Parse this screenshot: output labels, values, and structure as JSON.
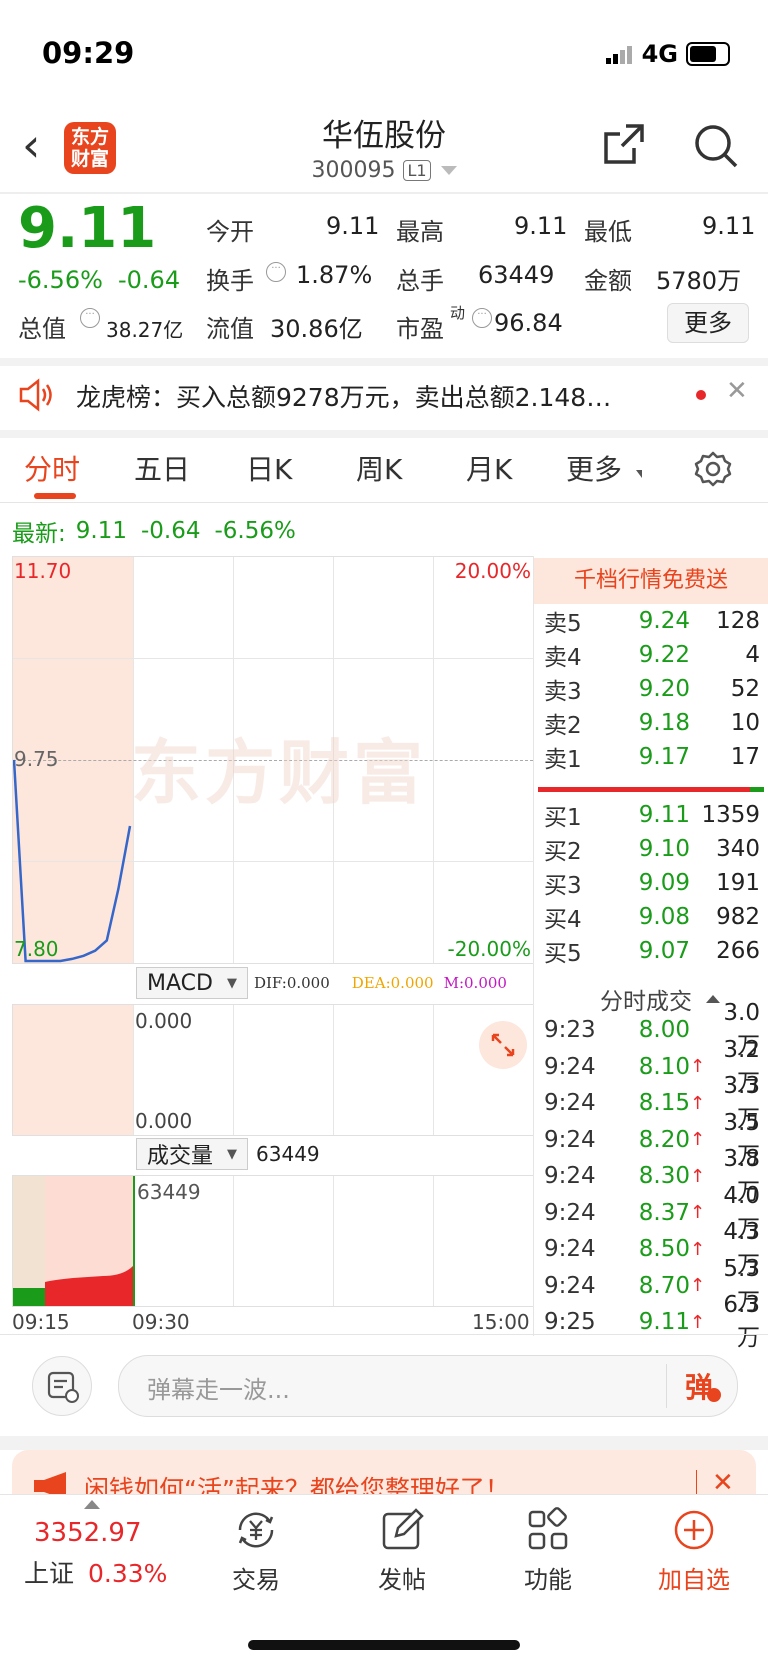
{
  "status": {
    "time": "09:29",
    "network": "4G"
  },
  "header": {
    "title": "华伍股份",
    "code": "300095",
    "level": "L1",
    "logo": "东方财富"
  },
  "quote": {
    "price": "9.11",
    "change_pct": "-6.56%",
    "change_amt": "-0.64",
    "open_label": "今开",
    "open": "9.11",
    "high_label": "最高",
    "high": "9.11",
    "low_label": "最低",
    "low": "9.11",
    "turnover_label": "换手",
    "turnover": "1.87%",
    "volume_label": "总手",
    "volume": "63449",
    "amount_label": "金额",
    "amount": "5780万",
    "total_mv_label": "总值",
    "total_mv": "38.27亿",
    "float_mv_label": "流值",
    "float_mv": "30.86亿",
    "pe_label": "市盈",
    "pe_sup": "动",
    "pe": "96.84",
    "more_label": "更多"
  },
  "notice": {
    "text": "龙虎榜：买入总额9278万元，卖出总额2.148…"
  },
  "tabs": [
    "分时",
    "五日",
    "日K",
    "周K",
    "月K",
    "更多"
  ],
  "latest": {
    "label": "最新:",
    "price": "9.11",
    "change": "-0.64",
    "pct": "-6.56%"
  },
  "chart": {
    "price_top": "11.70",
    "price_mid": "9.75",
    "price_bottom": "7.80",
    "pct_top": "20.00%",
    "pct_bottom": "-20.00%",
    "watermark": "东方财富",
    "macd_label": "MACD",
    "dif": "DIF:0.000",
    "dea": "DEA:0.000",
    "m": "M:0.000",
    "macd_top": "0.000",
    "macd_bottom": "0.000",
    "vol_label": "成交量",
    "vol_value": "63449",
    "vol_axis": "63449",
    "t_start": "09:15",
    "t_open": "09:30",
    "t_end": "15:00"
  },
  "chart_data": {
    "type": "line",
    "x": [
      "9:15",
      "9:16",
      "9:17",
      "9:18",
      "9:19",
      "9:20",
      "9:21",
      "9:22",
      "9:23",
      "9:24",
      "9:25"
    ],
    "series": [
      {
        "values": [
          9.75,
          7.8,
          7.8,
          7.8,
          7.8,
          7.82,
          7.85,
          7.9,
          8.0,
          8.5,
          9.11
        ]
      }
    ],
    "ylim": [
      7.8,
      11.7
    ]
  },
  "orderbook": {
    "banner": "千档行情免费送",
    "asks": [
      {
        "label": "卖5",
        "price": "9.24",
        "vol": "128"
      },
      {
        "label": "卖4",
        "price": "9.22",
        "vol": "4"
      },
      {
        "label": "卖3",
        "price": "9.20",
        "vol": "52"
      },
      {
        "label": "卖2",
        "price": "9.18",
        "vol": "10"
      },
      {
        "label": "卖1",
        "price": "9.17",
        "vol": "17"
      }
    ],
    "bids": [
      {
        "label": "买1",
        "price": "9.11",
        "vol": "1359"
      },
      {
        "label": "买2",
        "price": "9.10",
        "vol": "340"
      },
      {
        "label": "买3",
        "price": "9.09",
        "vol": "191"
      },
      {
        "label": "买4",
        "price": "9.08",
        "vol": "982"
      },
      {
        "label": "买5",
        "price": "9.07",
        "vol": "266"
      }
    ]
  },
  "trades": {
    "header": "分时成交",
    "rows": [
      {
        "time": "9:23",
        "price": "8.00",
        "arrow": "",
        "vol": "3.0万"
      },
      {
        "time": "9:24",
        "price": "8.10",
        "arrow": "↑",
        "vol": "3.2万"
      },
      {
        "time": "9:24",
        "price": "8.15",
        "arrow": "↑",
        "vol": "3.3万"
      },
      {
        "time": "9:24",
        "price": "8.20",
        "arrow": "↑",
        "vol": "3.5万"
      },
      {
        "time": "9:24",
        "price": "8.30",
        "arrow": "↑",
        "vol": "3.8万"
      },
      {
        "time": "9:24",
        "price": "8.37",
        "arrow": "↑",
        "vol": "4.0万"
      },
      {
        "time": "9:24",
        "price": "8.50",
        "arrow": "↑",
        "vol": "4.3万"
      },
      {
        "time": "9:24",
        "price": "8.70",
        "arrow": "↑",
        "vol": "5.3万"
      },
      {
        "time": "9:25",
        "price": "9.11",
        "arrow": "↑",
        "vol": "6.3万"
      }
    ]
  },
  "comment": {
    "placeholder": "弹幕走一波...",
    "danmu_label": "弹"
  },
  "ad": {
    "text": "闲钱如何“活”起来？都给您整理好了！"
  },
  "bottom_nav": {
    "index_value": "3352.97",
    "index_name": "上证",
    "index_pct": "0.33%",
    "trade": "交易",
    "post": "发帖",
    "func": "功能",
    "watch": "加自选"
  }
}
